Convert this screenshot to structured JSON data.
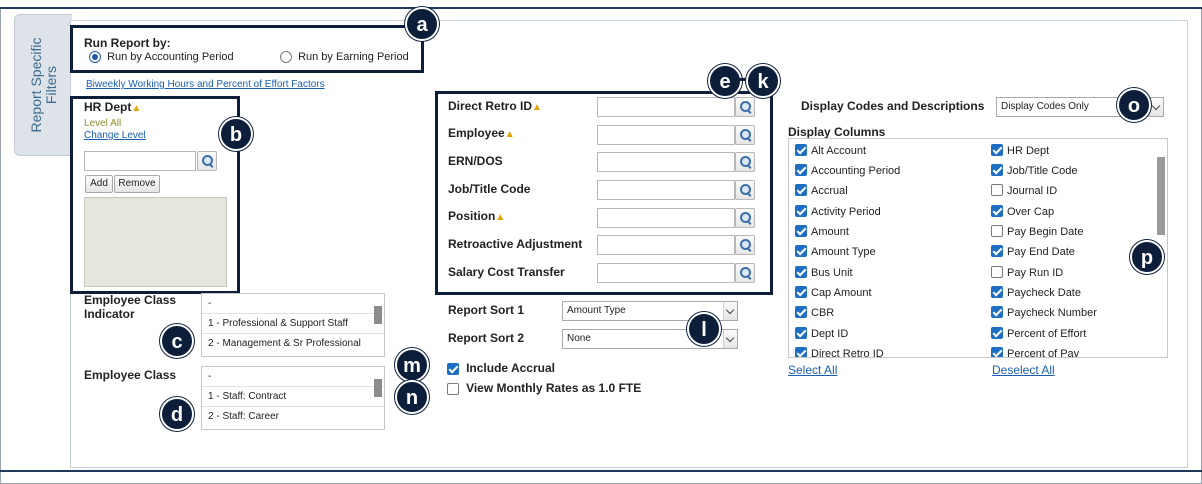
{
  "side_tab": {
    "label": "Report Specific Filters"
  },
  "run_report": {
    "title": "Run Report by:",
    "options": [
      {
        "label": "Run by Accounting Period",
        "selected": true
      },
      {
        "label": "Run by Earning Period",
        "selected": false
      }
    ]
  },
  "factors_link": "Biweekly Working Hours and Percent of Effort Factors",
  "hr_dept": {
    "title": "HR Dept",
    "level": "Level All",
    "change_level": "Change Level",
    "add_label": "Add",
    "remove_label": "Remove"
  },
  "employee_class_indicator": {
    "label": "Employee Class Indicator",
    "options": [
      "-",
      "1 - Professional & Support Staff",
      "2 - Management & Sr Professional"
    ]
  },
  "employee_class": {
    "label": "Employee Class",
    "options": [
      "-",
      "1 - Staff: Contract",
      "2 - Staff: Career"
    ]
  },
  "filters": [
    {
      "label": "Direct Retro ID",
      "required": true
    },
    {
      "label": "Employee",
      "required": true
    },
    {
      "label": "ERN/DOS",
      "required": false
    },
    {
      "label": "Job/Title Code",
      "required": false
    },
    {
      "label": "Position",
      "required": true
    },
    {
      "label": "Retroactive Adjustment",
      "required": false
    },
    {
      "label": "Salary Cost Transfer",
      "required": false
    }
  ],
  "report_sort": [
    {
      "label": "Report Sort 1",
      "value": "Amount Type"
    },
    {
      "label": "Report Sort 2",
      "value": "None"
    }
  ],
  "include_accrual": {
    "label": "Include Accrual",
    "checked": true
  },
  "monthly_rates": {
    "label": "View Monthly Rates as 1.0 FTE",
    "checked": false
  },
  "display_codes": {
    "label": "Display Codes and Descriptions",
    "value": "Display Codes Only"
  },
  "display_columns": {
    "title": "Display Columns",
    "left": [
      {
        "label": "Alt Account",
        "checked": true
      },
      {
        "label": "Accounting Period",
        "checked": true
      },
      {
        "label": "Accrual",
        "checked": true
      },
      {
        "label": "Activity Period",
        "checked": true
      },
      {
        "label": "Amount",
        "checked": true
      },
      {
        "label": "Amount Type",
        "checked": true
      },
      {
        "label": "Bus Unit",
        "checked": true
      },
      {
        "label": "Cap Amount",
        "checked": true
      },
      {
        "label": "CBR",
        "checked": true
      },
      {
        "label": "Dept ID",
        "checked": true
      },
      {
        "label": "Direct Retro ID",
        "checked": true
      }
    ],
    "right": [
      {
        "label": "HR Dept",
        "checked": true
      },
      {
        "label": "Job/Title Code",
        "checked": true
      },
      {
        "label": "Journal ID",
        "checked": false
      },
      {
        "label": "Over Cap",
        "checked": true
      },
      {
        "label": "Pay Begin Date",
        "checked": false
      },
      {
        "label": "Pay End Date",
        "checked": true
      },
      {
        "label": "Pay Run ID",
        "checked": false
      },
      {
        "label": "Paycheck Date",
        "checked": true
      },
      {
        "label": "Paycheck Number",
        "checked": true
      },
      {
        "label": "Percent of Effort",
        "checked": true
      },
      {
        "label": "Percent of Pay",
        "checked": true
      }
    ],
    "select_all": "Select All",
    "deselect_all": "Deselect All"
  },
  "callouts": {
    "a": "a",
    "b": "b",
    "c": "c",
    "d": "d",
    "e": "e",
    "dash": "-",
    "k": "k",
    "l": "l",
    "m": "m",
    "n": "n",
    "o": "o",
    "p": "p"
  },
  "colors": {
    "callout": "#0c1e3a",
    "link": "#1a5fb4",
    "warn": "#e2a100",
    "checkbox": "#1e6fc4"
  }
}
